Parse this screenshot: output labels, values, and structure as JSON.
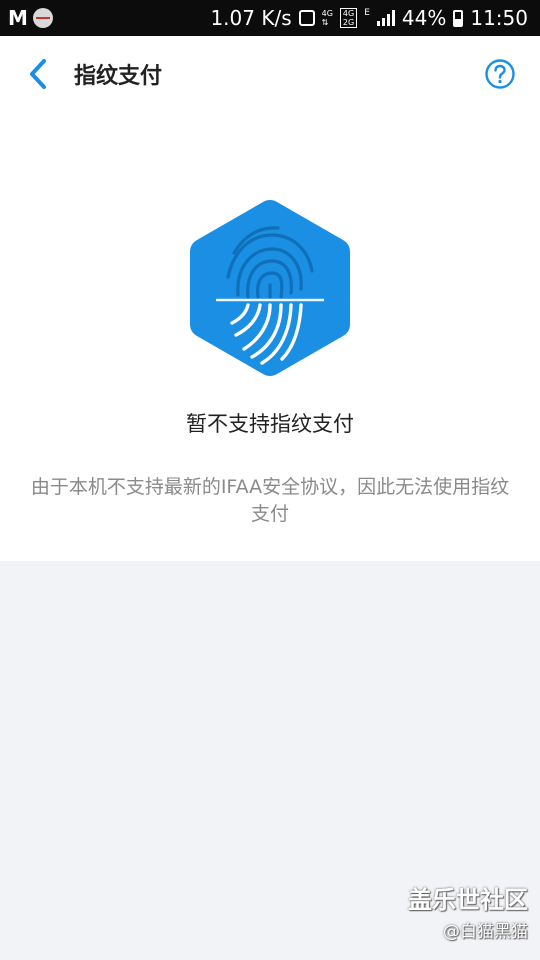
{
  "status_bar": {
    "left_logo": "M",
    "net_speed": "1.07 K/s",
    "net_4g": "4G",
    "net_4g_box": "4G",
    "net_2g_box": "2G",
    "net_e": "E",
    "battery": "44%",
    "time": "11:50"
  },
  "header": {
    "title": "指纹支付",
    "back_icon": "chevron-left-icon",
    "help_icon": "question-circle-icon"
  },
  "content": {
    "icon": "fingerprint-hexagon-icon",
    "message": "暂不支持指纹支付",
    "description": "由于本机不支持最新的IFAA安全协议，因此无法使用指纹支付"
  },
  "watermark": {
    "title": "盖乐世社区",
    "subtitle": "@白猫黑猫"
  },
  "colors": {
    "accent": "#1a8fe3",
    "icon_bg": "#1a8fe3",
    "background": "#f2f3f7",
    "title_text": "#222222",
    "secondary_text": "#8a8a8a"
  }
}
